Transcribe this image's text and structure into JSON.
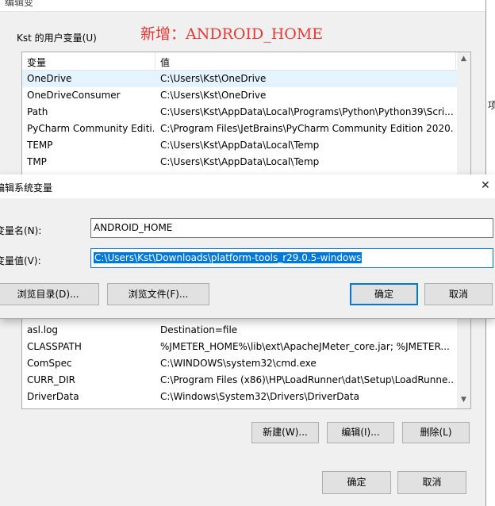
{
  "background_window": {
    "title": "编辑变",
    "right_edge_text": "项",
    "user_vars_group_label": "Kst 的用户变量(U)",
    "annotation": "新增：ANDROID_HOME",
    "user_vars_table": {
      "headers": [
        "变量",
        "值"
      ],
      "rows": [
        {
          "name": "OneDrive",
          "value": "C:\\Users\\Kst\\OneDrive"
        },
        {
          "name": "OneDriveConsumer",
          "value": "C:\\Users\\Kst\\OneDrive"
        },
        {
          "name": "Path",
          "value": "C:\\Users\\Kst\\AppData\\Local\\Programs\\Python\\Python39\\Scri..."
        },
        {
          "name": "PyCharm Community Editi...",
          "value": "C:\\Program Files\\JetBrains\\PyCharm Community Edition 2020...."
        },
        {
          "name": "TEMP",
          "value": "C:\\Users\\Kst\\AppData\\Local\\Temp"
        },
        {
          "name": "TMP",
          "value": "C:\\Users\\Kst\\AppData\\Local\\Temp"
        }
      ]
    },
    "system_vars_table": {
      "rows": [
        {
          "name": "asl.log",
          "value": "Destination=file"
        },
        {
          "name": "CLASSPATH",
          "value": "%JMETER_HOME%\\lib\\ext\\ApacheJMeter_core.jar; %JMETER..."
        },
        {
          "name": "ComSpec",
          "value": "C:\\WINDOWS\\system32\\cmd.exe"
        },
        {
          "name": "CURR_DIR",
          "value": "C:\\Program Files (x86)\\HP\\LoadRunner\\dat\\Setup\\LoadRunne..."
        },
        {
          "name": "DriverData",
          "value": "C:\\Windows\\System32\\Drivers\\DriverData"
        }
      ]
    },
    "buttons": {
      "new": "新建(W)...",
      "edit": "编辑(I)...",
      "delete": "删除(L)",
      "ok": "确定",
      "cancel": "取消"
    }
  },
  "dialog": {
    "title": "编辑系统变量",
    "close": "✕",
    "name_label": "变量名(N):",
    "name_value": "ANDROID_HOME",
    "value_label": "变量值(V):",
    "value_value": "C:\\Users\\Kst\\Downloads\\platform-tools_r29.0.5-windows",
    "browse_dir": "浏览目录(D)...",
    "browse_file": "浏览文件(F)...",
    "ok": "确定",
    "cancel": "取消"
  },
  "colors": {
    "annotation": "#e53935",
    "accent": "#0078d7",
    "selected_row": "#e5f3ff"
  },
  "icons": {
    "scroll_up": "▲",
    "scroll_down": "▼"
  }
}
